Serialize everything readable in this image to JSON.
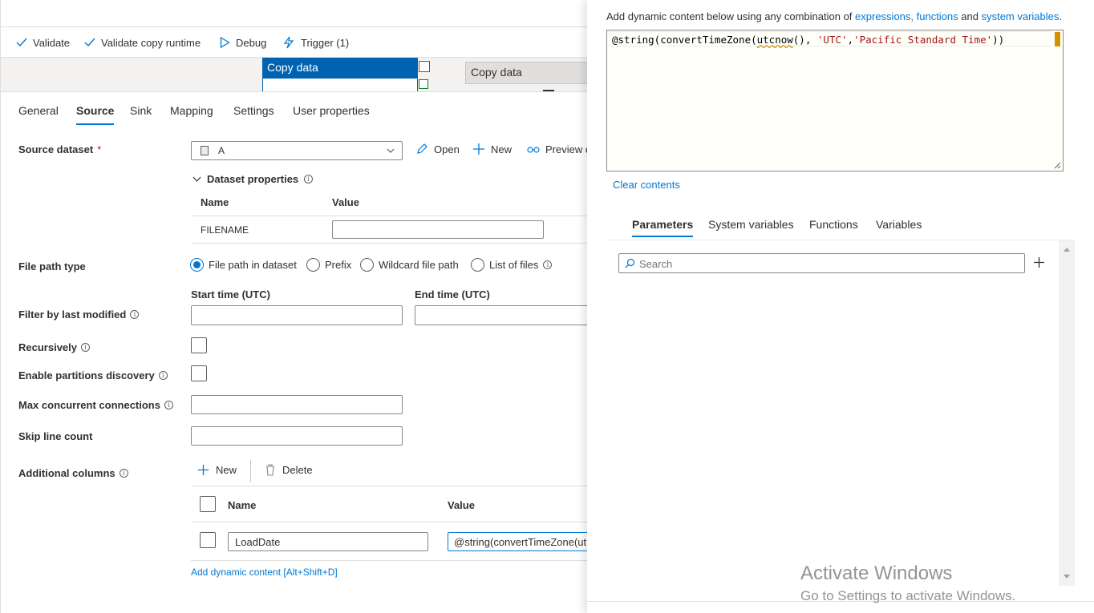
{
  "toolbar": {
    "validate": "Validate",
    "validate_copy_runtime": "Validate copy runtime",
    "debug": "Debug",
    "trigger": "Trigger (1)"
  },
  "canvas": {
    "activity_selected": "Copy data",
    "activity_other": "Copy data"
  },
  "tabs": [
    "General",
    "Source",
    "Sink",
    "Mapping",
    "Settings",
    "User properties"
  ],
  "active_tab": "Source",
  "source": {
    "dataset_label": "Source dataset",
    "required_marker": "*",
    "dataset_value": "A",
    "open": "Open",
    "new": "New",
    "preview": "Preview d",
    "dataset_properties": "Dataset properties",
    "props_name_header": "Name",
    "props_value_header": "Value",
    "prop_row_name": "FILENAME",
    "file_path_type_label": "File path type",
    "file_path_options": [
      "File path in dataset",
      "Prefix",
      "Wildcard file path",
      "List of files"
    ],
    "file_path_selected": "File path in dataset",
    "start_time_label": "Start time (UTC)",
    "end_time_label": "End time (UTC)",
    "filter_label": "Filter by last modified",
    "recursively_label": "Recursively",
    "partitions_label": "Enable partitions discovery",
    "max_conn_label": "Max concurrent connections",
    "skip_line_label": "Skip line count",
    "additional_columns_label": "Additional columns",
    "add_new": "New",
    "delete": "Delete",
    "col_name_header": "Name",
    "col_value_header": "Value",
    "col_row_name": "LoadDate",
    "col_row_value": "@string(convertTimeZone(ut",
    "add_dynamic": "Add dynamic content [Alt+Shift+D]"
  },
  "dynamic": {
    "intro_prefix": "Add dynamic content below using any combination of ",
    "intro_link1": "expressions, functions",
    "intro_mid": " and ",
    "intro_link2": "system variables",
    "intro_end": ".",
    "expr_part1": "@string(convertTimeZone(",
    "expr_fn": "utcnow",
    "expr_part2": "(), ",
    "expr_str1": "'UTC'",
    "expr_comma": ",",
    "expr_str2": "'Pacific Standard Time'",
    "expr_end": "))",
    "clear": "Clear contents",
    "tabs": [
      "Parameters",
      "System variables",
      "Functions",
      "Variables"
    ],
    "active_tab": "Parameters",
    "search_placeholder": "Search"
  },
  "watermark": {
    "line1": "Activate Windows",
    "line2": "Go to Settings to activate Windows."
  },
  "colors": {
    "accent": "#0078d4",
    "selected_activity": "#0063b1",
    "string_literal": "#a31515"
  }
}
